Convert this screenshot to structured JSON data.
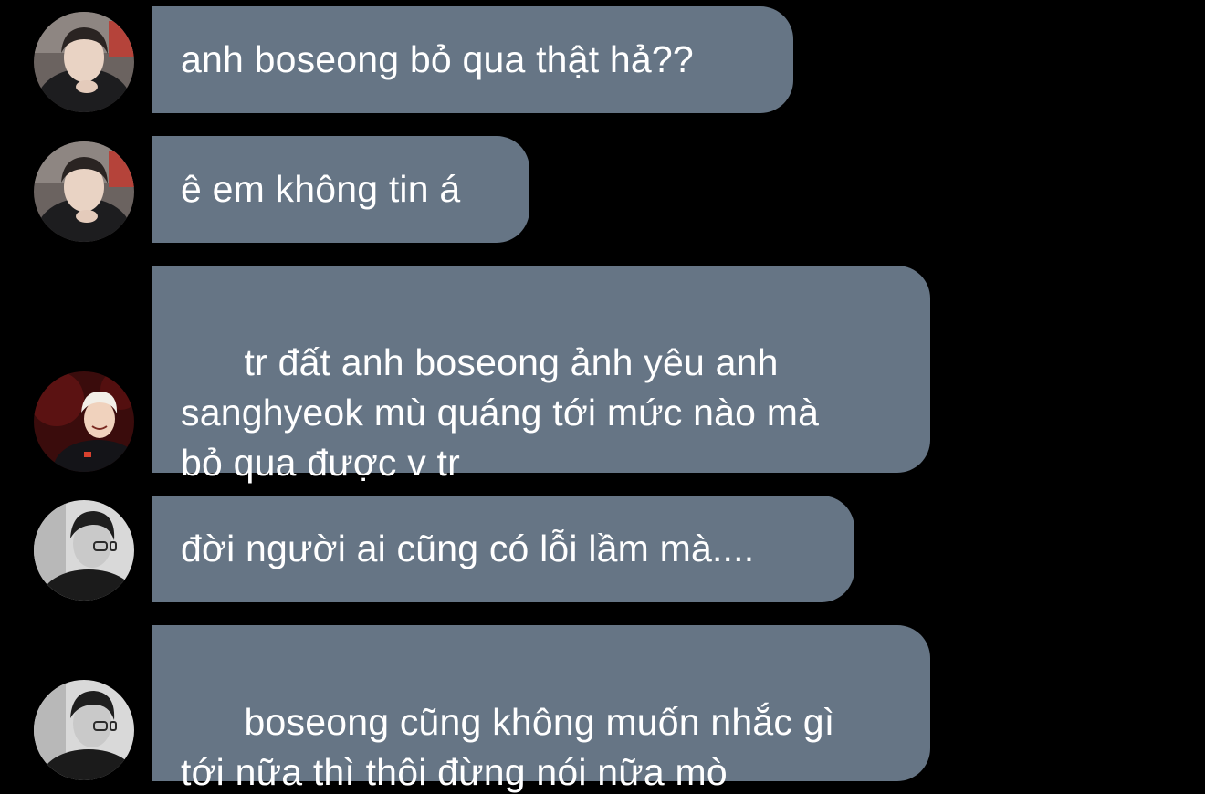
{
  "messages": [
    {
      "avatar": "avatar-hoodie-boy",
      "text": "anh boseong bỏ qua thật hả??"
    },
    {
      "avatar": "avatar-hoodie-boy",
      "text": "ê em không tin á"
    },
    {
      "avatar": "avatar-blond-player",
      "text": "tr đất anh boseong ảnh yêu anh\nsanghyeok mù quáng tới mức nào mà\nbỏ qua được v tr"
    },
    {
      "avatar": "avatar-glasses-player",
      "text": "đời người ai cũng có lỗi lầm mà...."
    },
    {
      "avatar": "avatar-glasses-player",
      "text": "boseong cũng không muốn nhắc gì\ntới nữa thì thôi đừng nói nữa mò"
    }
  ],
  "colors": {
    "background": "#000000",
    "bubble": "#667585",
    "text": "#ffffff"
  }
}
